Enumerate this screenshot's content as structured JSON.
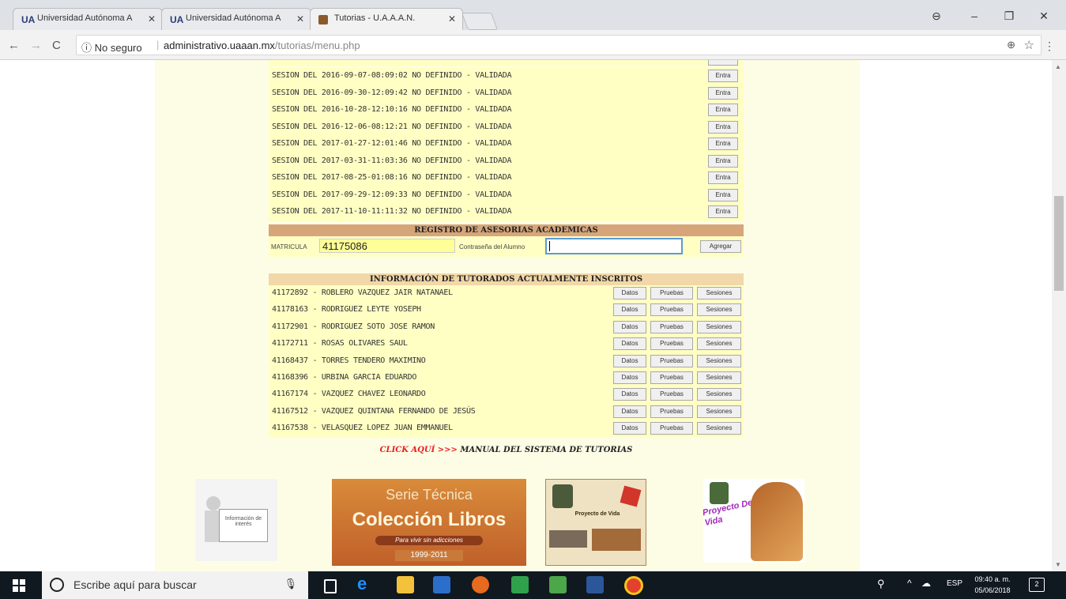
{
  "browser": {
    "tabs": [
      {
        "title": "Universidad Autónoma A",
        "favicon": "UA"
      },
      {
        "title": "Universidad Autónoma A",
        "favicon": "UA"
      },
      {
        "title": "Tutorias - U.A.A.A.N.",
        "favicon": "crest"
      }
    ],
    "security_label": "No seguro",
    "url_host": "administrativo.uaaan.mx",
    "url_path": "/tutorias/menu.php"
  },
  "sessions": {
    "button_label": "Entra",
    "items": [
      "SESION DEL 2016-09-07-08:09:02 NO DEFINIDO - VALIDADA",
      "SESION DEL 2016-09-30-12:09:42 NO DEFINIDO - VALIDADA",
      "SESION DEL 2016-10-28-12:10:16 NO DEFINIDO - VALIDADA",
      "SESION DEL 2016-12-06-08:12:21 NO DEFINIDO - VALIDADA",
      "SESION DEL 2017-01-27-12:01:46 NO DEFINIDO - VALIDADA",
      "SESION DEL 2017-03-31-11:03:36 NO DEFINIDO - VALIDADA",
      "SESION DEL 2017-08-25-01:08:16 NO DEFINIDO - VALIDADA",
      "SESION DEL 2017-09-29-12:09:33 NO DEFINIDO - VALIDADA",
      "SESION DEL 2017-11-10-11:11:32 NO DEFINIDO - VALIDADA"
    ]
  },
  "registro": {
    "title": "REGISTRO DE ASESORIAS ACADEMICAS",
    "matricula_label": "MATRICULA",
    "matricula_value": "41175086",
    "password_label": "Contraseña del Alumno",
    "password_value": "",
    "add_button": "Agregar"
  },
  "tutorados": {
    "title": "INFORMACIÓN DE TUTORADOS ACTUALMENTE INSCRITOS",
    "buttons": {
      "datos": "Datos",
      "pruebas": "Pruebas",
      "sesiones": "Sesiones"
    },
    "items": [
      "41172892 - ROBLERO VAZQUEZ JAIR NATANAEL",
      "41178163 - RODRIGUEZ LEYTE YOSEPH",
      "41172901 - RODRIGUEZ SOTO JOSE RAMON",
      "41172711 - ROSAS OLIVARES SAUL",
      "41168437 - TORRES TENDERO MAXIMINO",
      "41168396 - URBINA GARCIA EDUARDO",
      "41167174 - VAZQUEZ CHAVEZ LEONARDO",
      "41167512 - VAZQUEZ QUINTANA FERNANDO DE JESÚS",
      "41167538 - VELASQUEZ LOPEZ JUAN EMMANUEL"
    ]
  },
  "manual": {
    "click": "CLICK AQUÍ >>>",
    "text": "MANUAL DEL SISTEMA DE TUTORIAS"
  },
  "banners": {
    "info_text": "Información de interés",
    "serie_title": "Serie Técnica",
    "coleccion": "Colección Libros",
    "adicciones": "Para vivir sin adicciones",
    "years": "1999-2011",
    "proyecto_vida_1": "Proyecto de Vida",
    "proyecto_vida_2": "Proyecto De Vida"
  },
  "taskbar": {
    "search_placeholder": "Escribe aquí para buscar",
    "lang": "ESP",
    "time": "09:40 a. m.",
    "date": "05/06/2018",
    "notif_count": "2"
  }
}
